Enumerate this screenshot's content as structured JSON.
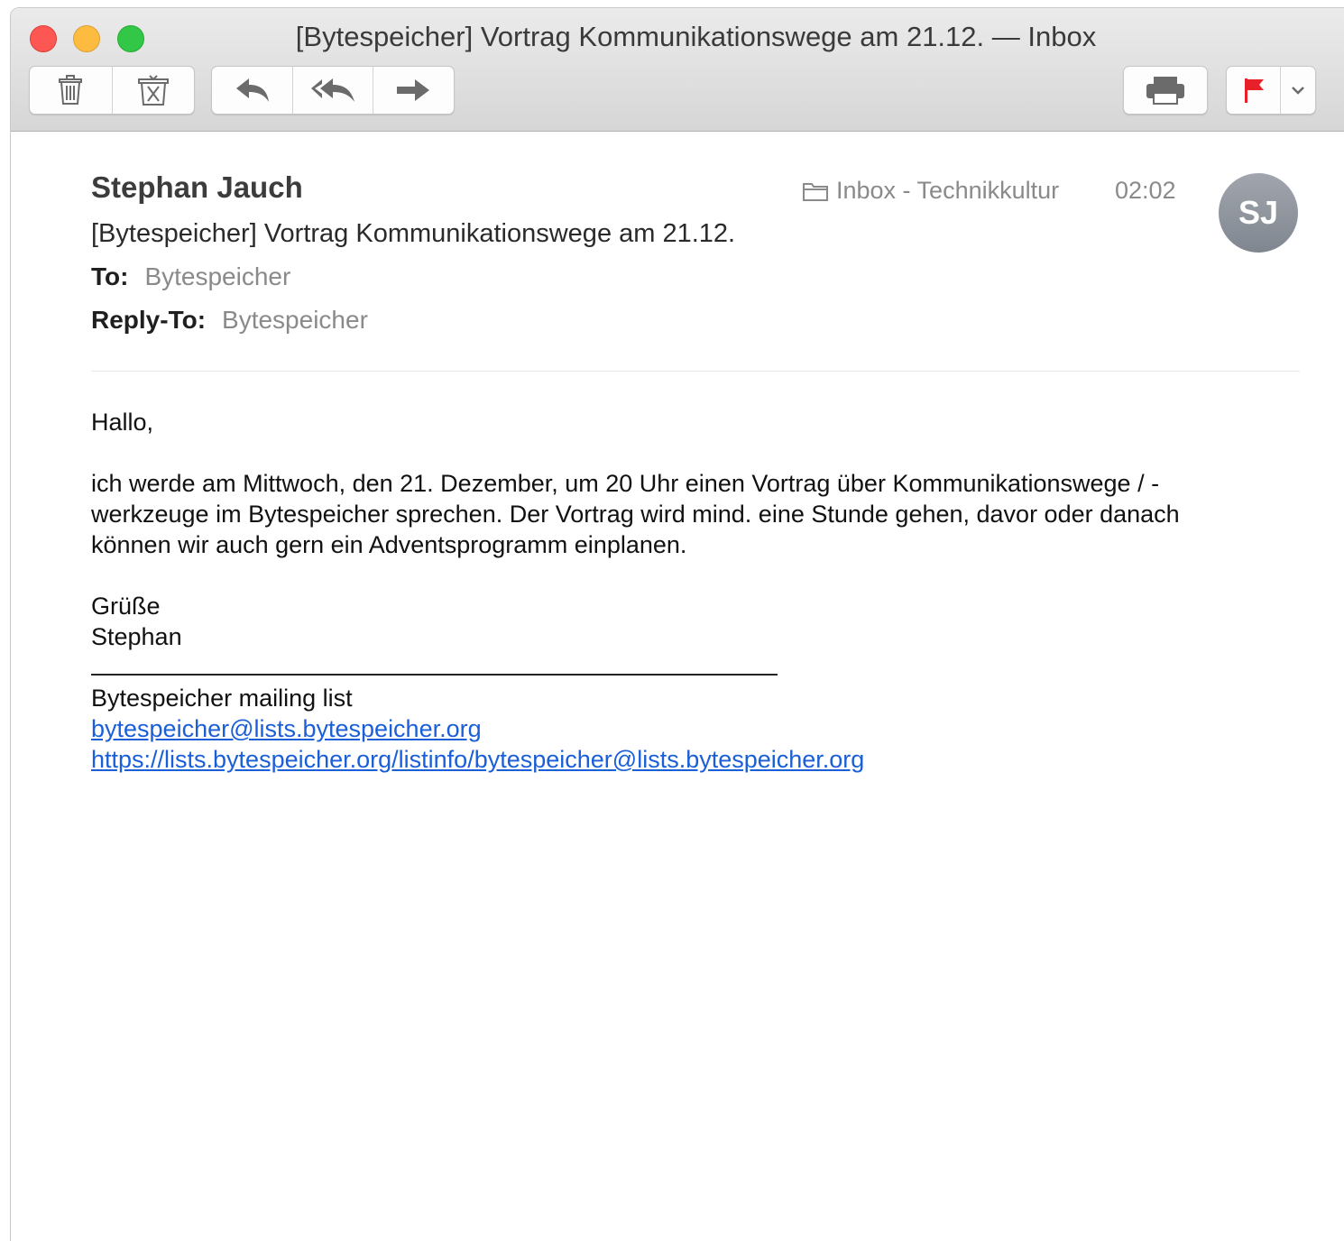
{
  "window": {
    "title": "[Bytespeicher] Vortrag Kommunikationswege am 21.12. — Inbox"
  },
  "toolbar": {
    "buttons": [
      {
        "name": "delete",
        "icon": "trash-icon"
      },
      {
        "name": "junk",
        "icon": "junk-icon"
      },
      {
        "name": "reply",
        "icon": "reply-icon"
      },
      {
        "name": "reply-all",
        "icon": "reply-all-icon"
      },
      {
        "name": "forward",
        "icon": "forward-icon"
      },
      {
        "name": "print",
        "icon": "printer-icon"
      },
      {
        "name": "flag",
        "icon": "flag-icon",
        "color": "#e8202a"
      },
      {
        "name": "flag-menu",
        "icon": "chevron-down-icon"
      }
    ]
  },
  "message": {
    "from": "Stephan Jauch",
    "subject": "[Bytespeicher] Vortrag Kommunikationswege am 21.12.",
    "to_label": "To:",
    "to_value": "Bytespeicher",
    "reply_to_label": "Reply-To:",
    "reply_to_value": "Bytespeicher",
    "mailbox": "Inbox - Technikkultur",
    "time": "02:02",
    "avatar_initials": "SJ",
    "body": {
      "greeting": "Hallo,",
      "paragraph_line1": "ich werde am Mittwoch, den 21. Dezember, um 20 Uhr einen Vortrag über Kommunikationswege / -",
      "paragraph_line2": "werkzeuge im Bytespeicher sprechen. Der Vortrag wird mind. eine Stunde gehen, davor oder danach",
      "paragraph_line3": "können wir auch gern ein Adventsprogramm einplanen.",
      "closing": "Grüße",
      "signature": "Stephan",
      "footer_title": "Bytespeicher mailing list",
      "footer_email": "bytespeicher@lists.bytespeicher.org",
      "footer_url": "https://lists.bytespeicher.org/listinfo/bytespeicher@lists.bytespeicher.org"
    }
  },
  "colors": {
    "link": "#1a5fd8",
    "flag": "#e8202a",
    "close": "#fc5753",
    "minimize": "#fdbc40",
    "maximize": "#33c748"
  }
}
